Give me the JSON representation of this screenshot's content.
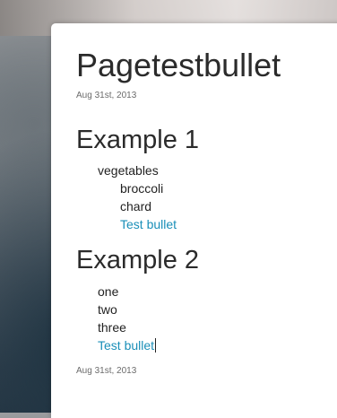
{
  "page": {
    "title": "Pagetestbullet",
    "date_top": "Aug 31st, 2013",
    "date_bottom": "Aug 31st, 2013"
  },
  "example1": {
    "heading": "Example 1",
    "parent_item": "vegetables",
    "children": [
      "broccoli",
      "chard",
      "Test bullet"
    ]
  },
  "example2": {
    "heading": "Example 2",
    "items": [
      "one",
      "two",
      "three",
      "Test bullet"
    ]
  },
  "colors": {
    "link_text": "#1a8fb8",
    "body_text": "#222222",
    "card_background": "#ffffff"
  }
}
